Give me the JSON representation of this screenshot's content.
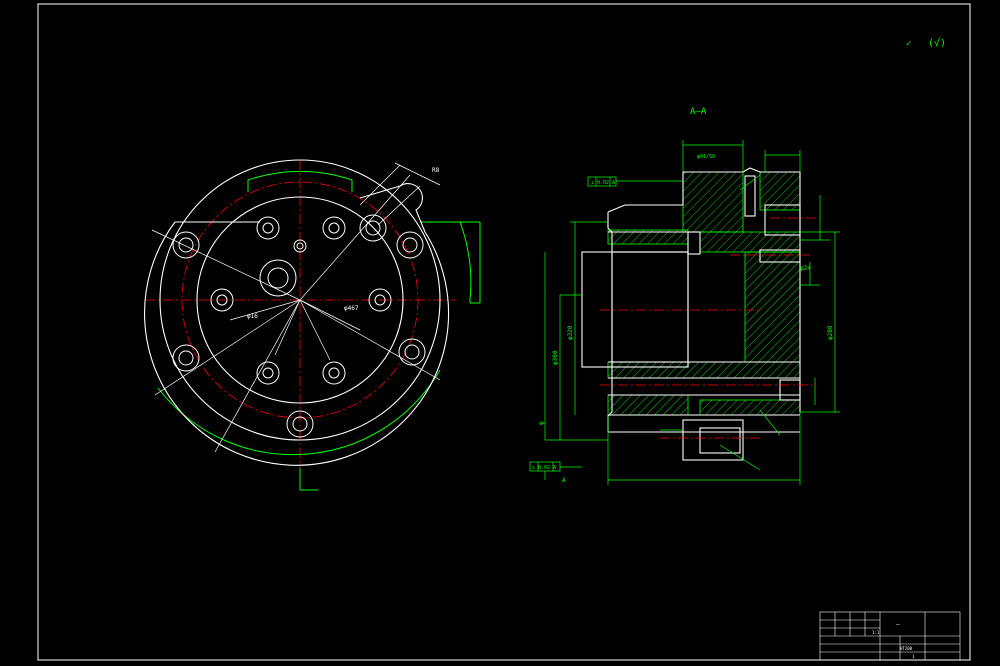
{
  "drawing": {
    "background": "#000000",
    "colors": {
      "outline": "#ffffff",
      "dimension": "#00ff00",
      "centerline": "#ff0000",
      "hatch": "#00ff00",
      "hidden": "#ffff00",
      "text_accent": "#ffff00"
    },
    "roughness_note": "(√)",
    "section_label": "A—A",
    "front_view": {
      "dim_bolt_circle": "φ16",
      "dim_pcd": "φ467",
      "dim_radius_left": "R8"
    },
    "section_view": {
      "dims_left": [
        "φ320",
        "φ360",
        "φ"
      ],
      "dims_right": [
        "φ280",
        "φ24"
      ],
      "dims_top": [
        "φ01/50"
      ],
      "dim_bottom": "",
      "tolerance_frames": [
        "⊥ 0.02 A",
        "◎ 0.02 A"
      ],
      "datum_label": "A"
    },
    "title_block": {
      "part_name": "—",
      "company": "",
      "scale": "1:1",
      "material": "HT200",
      "sheet": "1"
    }
  }
}
